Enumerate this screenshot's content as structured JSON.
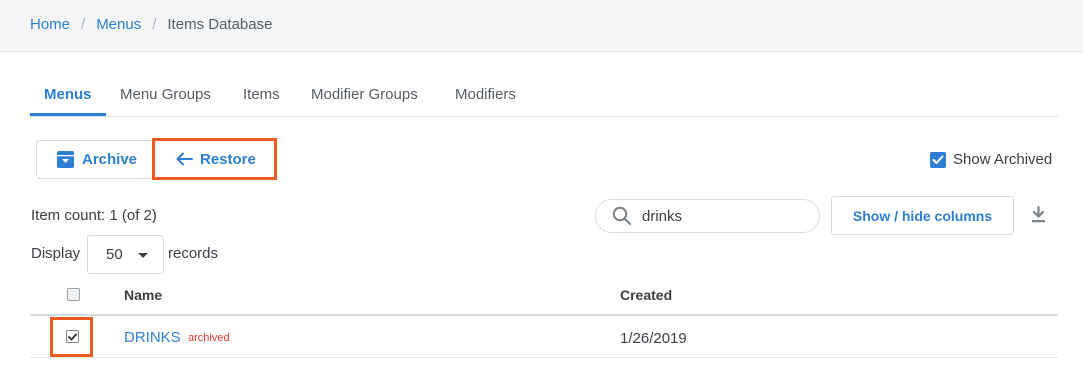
{
  "breadcrumb": {
    "home": "Home",
    "menus": "Menus",
    "current": "Items Database"
  },
  "tabs": [
    {
      "label": "Menus",
      "active": true
    },
    {
      "label": "Menu Groups",
      "active": false
    },
    {
      "label": "Items",
      "active": false
    },
    {
      "label": "Modifier Groups",
      "active": false
    },
    {
      "label": "Modifiers",
      "active": false
    }
  ],
  "toolbar": {
    "archive_label": "Archive",
    "archive_icon": "archive-box-icon",
    "restore_label": "Restore",
    "restore_icon": "arrow-left-icon",
    "show_archived_label": "Show Archived",
    "show_archived_checked": true
  },
  "list": {
    "item_count": "Item count: 1 (of 2)",
    "search_value": "drinks",
    "search_icon": "search-icon",
    "columns_button": "Show / hide columns",
    "download_icon": "download-icon",
    "display_label": "Display",
    "display_value": "50",
    "records_label": "records"
  },
  "table": {
    "headers": {
      "name": "Name",
      "created": "Created"
    },
    "rows": [
      {
        "name": "DRINKS",
        "badge": "archived",
        "created": "1/26/2019",
        "checked": true
      }
    ]
  },
  "colors": {
    "accent": "#2d7fd3",
    "highlight": "#f05a22",
    "archived_badge": "#e03a2f"
  }
}
